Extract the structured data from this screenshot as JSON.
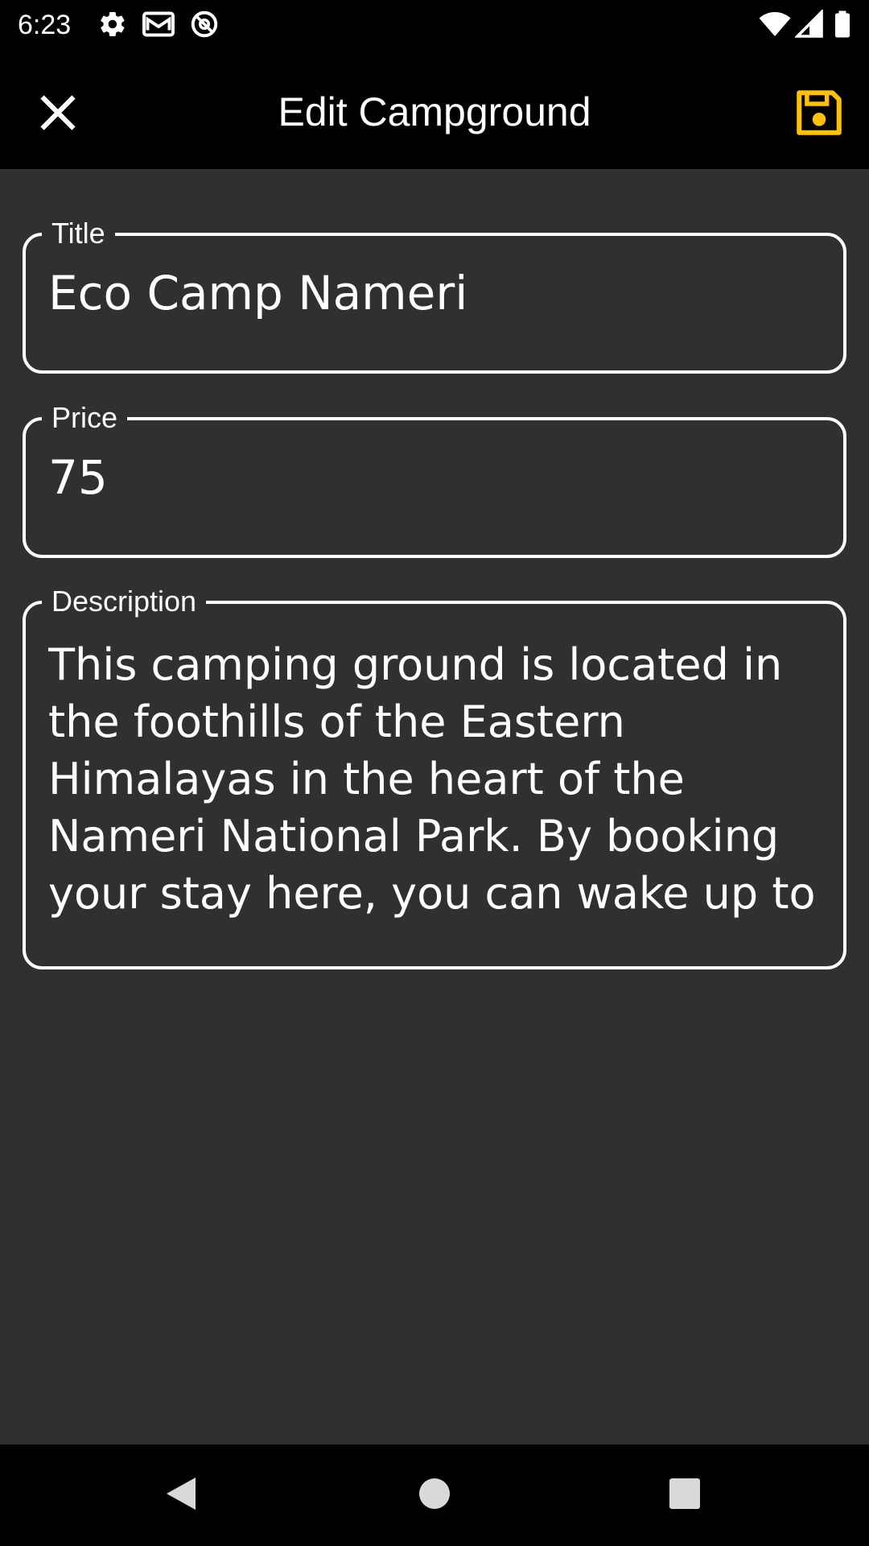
{
  "status_bar": {
    "time": "6:23",
    "left_icons": [
      "gear-icon",
      "gmail-icon",
      "at-sign-icon"
    ],
    "right_icons": [
      "wifi-icon",
      "signal-icon",
      "battery-icon"
    ]
  },
  "app_bar": {
    "title": "Edit Campground",
    "close_icon": "close-icon",
    "save_icon": "save-icon",
    "accent_color": "#FFC107"
  },
  "form": {
    "title": {
      "label": "Title",
      "value": "Eco Camp Nameri"
    },
    "price": {
      "label": "Price",
      "value": "75"
    },
    "description": {
      "label": "Description",
      "value": "This camping ground is located in\nthe foothills of the Eastern\nHimalayas in the heart of the\nNameri National Park. By booking\nyour stay here, you can wake up to"
    }
  },
  "nav_bar": {
    "icons": [
      "back-icon",
      "home-icon",
      "recents-icon"
    ]
  }
}
